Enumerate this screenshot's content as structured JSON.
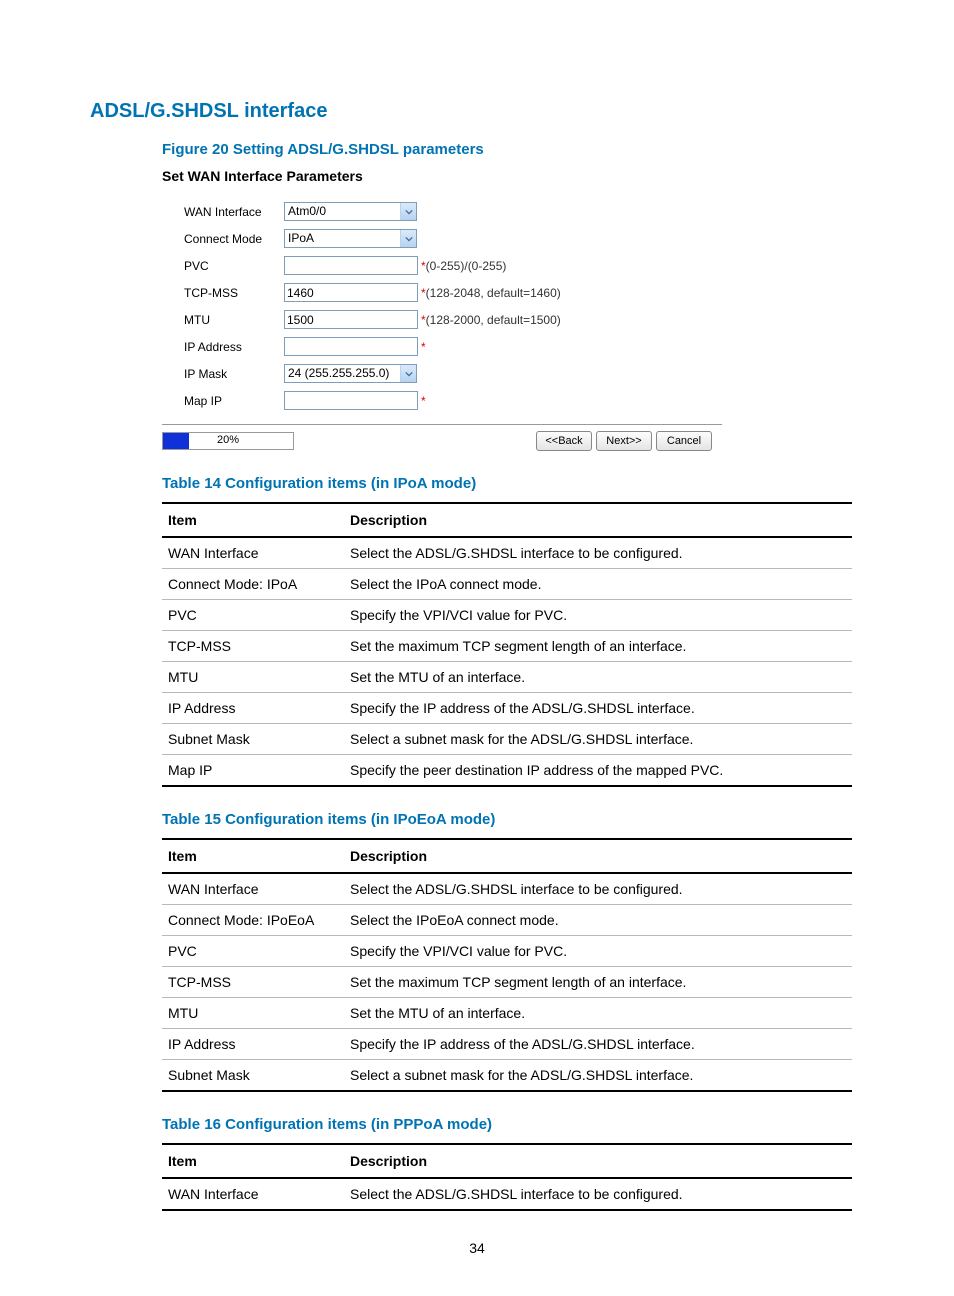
{
  "page_number": "34",
  "section_heading": "ADSL/G.SHDSL interface",
  "figure_caption": "Figure 20 Setting ADSL/G.SHDSL parameters",
  "shot": {
    "title": "Set WAN Interface Parameters",
    "labels": {
      "wan_if": "WAN Interface",
      "connect_mode": "Connect Mode",
      "pvc": "PVC",
      "tcp_mss": "TCP-MSS",
      "mtu": "MTU",
      "ip_addr": "IP Address",
      "ip_mask": "IP Mask",
      "map_ip": "Map IP"
    },
    "values": {
      "wan_if": "Atm0/0",
      "connect_mode": "IPoA",
      "pvc": "",
      "tcp_mss": "1460",
      "mtu": "1500",
      "ip_addr": "",
      "ip_mask": "24 (255.255.255.0)",
      "map_ip": ""
    },
    "hints": {
      "pvc": "*(0-255)/(0-255)",
      "tcp_mss": "*(128-2048, default=1460)",
      "mtu": "*(128-2000, default=1500)",
      "star": "*"
    },
    "progress": {
      "pct": 20,
      "label": "20%"
    },
    "buttons": {
      "back": "<<Back",
      "next": "Next>>",
      "cancel": "Cancel"
    }
  },
  "table14": {
    "caption": "Table 14 Configuration items (in IPoA mode)",
    "head": {
      "item": "Item",
      "desc": "Description"
    },
    "rows": [
      {
        "item": "WAN Interface",
        "desc": "Select the ADSL/G.SHDSL interface to be configured."
      },
      {
        "item": "Connect Mode: IPoA",
        "desc": "Select the IPoA connect mode."
      },
      {
        "item": "PVC",
        "desc": "Specify the VPI/VCI value for PVC."
      },
      {
        "item": "TCP-MSS",
        "desc": "Set the maximum TCP segment length of an interface."
      },
      {
        "item": "MTU",
        "desc": "Set the MTU of an interface."
      },
      {
        "item": "IP Address",
        "desc": "Specify the IP address of the ADSL/G.SHDSL interface."
      },
      {
        "item": "Subnet Mask",
        "desc": "Select a subnet mask for the ADSL/G.SHDSL interface."
      },
      {
        "item": "Map IP",
        "desc": "Specify the peer destination IP address of the mapped PVC."
      }
    ]
  },
  "table15": {
    "caption": "Table 15 Configuration items (in IPoEoA mode)",
    "head": {
      "item": "Item",
      "desc": "Description"
    },
    "rows": [
      {
        "item": "WAN Interface",
        "desc": "Select the ADSL/G.SHDSL interface to be configured."
      },
      {
        "item": "Connect Mode: IPoEoA",
        "desc": "Select the IPoEoA connect mode."
      },
      {
        "item": "PVC",
        "desc": "Specify the VPI/VCI value for PVC."
      },
      {
        "item": "TCP-MSS",
        "desc": "Set the maximum TCP segment length of an interface."
      },
      {
        "item": "MTU",
        "desc": "Set the MTU of an interface."
      },
      {
        "item": "IP Address",
        "desc": "Specify the IP address of the ADSL/G.SHDSL interface."
      },
      {
        "item": "Subnet Mask",
        "desc": "Select a subnet mask for the ADSL/G.SHDSL interface."
      }
    ]
  },
  "table16": {
    "caption": "Table 16 Configuration items (in PPPoA mode)",
    "head": {
      "item": "Item",
      "desc": "Description"
    },
    "rows": [
      {
        "item": "WAN Interface",
        "desc": "Select the ADSL/G.SHDSL interface to be configured."
      }
    ]
  }
}
